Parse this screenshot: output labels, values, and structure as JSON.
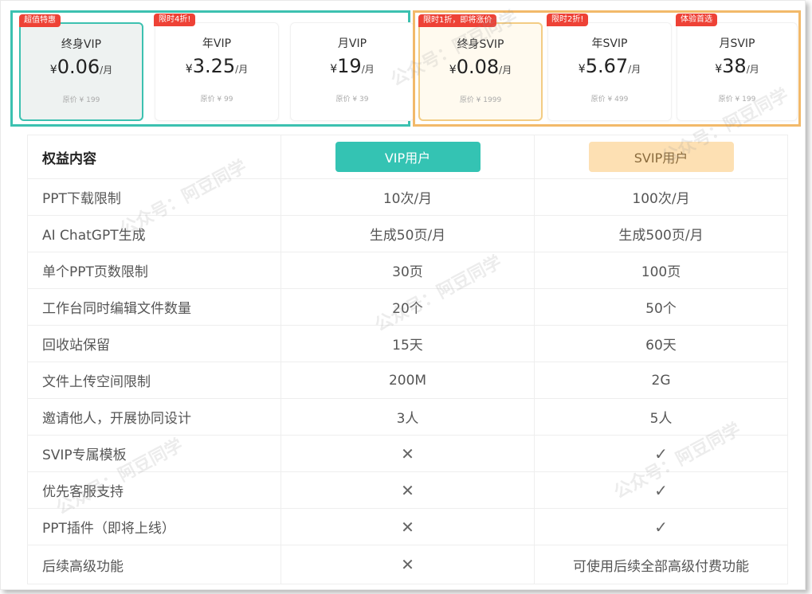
{
  "plans": {
    "vip": [
      {
        "tag": "超值特惠",
        "name": "终身VIP",
        "currency": "¥",
        "price": "0.06",
        "unit": "/月",
        "original": "原价 ¥ 199"
      },
      {
        "tag": "限时4折!",
        "name": "年VIP",
        "currency": "¥",
        "price": "3.25",
        "unit": "/月",
        "original": "原价 ¥ 99"
      },
      {
        "tag": "",
        "name": "月VIP",
        "currency": "¥",
        "price": "19",
        "unit": "/月",
        "original": "原价 ¥ 39"
      }
    ],
    "svip": [
      {
        "tag": "限时1折，即将涨价",
        "name": "终身SVIP",
        "currency": "¥",
        "price": "0.08",
        "unit": "/月",
        "original": "原价 ¥ 1999"
      },
      {
        "tag": "限时2折!",
        "name": "年SVIP",
        "currency": "¥",
        "price": "5.67",
        "unit": "/月",
        "original": "原价 ¥ 499"
      },
      {
        "tag": "体验首选",
        "name": "月SVIP",
        "currency": "¥",
        "price": "38",
        "unit": "/月",
        "original": "原价 ¥ 199"
      }
    ]
  },
  "table": {
    "header": {
      "feature": "权益内容",
      "vip": "VIP用户",
      "svip": "SVIP用户"
    },
    "rows": [
      {
        "feature": "PPT下载限制",
        "vip": "10次/月",
        "svip": "100次/月"
      },
      {
        "feature": "AI ChatGPT生成",
        "vip": "生成50页/月",
        "svip": "生成500页/月"
      },
      {
        "feature": "单个PPT页数限制",
        "vip": "30页",
        "svip": "100页"
      },
      {
        "feature": "工作台同时编辑文件数量",
        "vip": "20个",
        "svip": "50个"
      },
      {
        "feature": "回收站保留",
        "vip": "15天",
        "svip": "60天"
      },
      {
        "feature": "文件上传空间限制",
        "vip": "200M",
        "svip": "2G"
      },
      {
        "feature": "邀请他人，开展协同设计",
        "vip": "3人",
        "svip": "5人"
      },
      {
        "feature": "SVIP专属模板",
        "vip": "✕",
        "svip": "✓"
      },
      {
        "feature": "优先客服支持",
        "vip": "✕",
        "svip": "✓"
      },
      {
        "feature": "PPT插件（即将上线）",
        "vip": "✕",
        "svip": "✓"
      },
      {
        "feature": "后续高级功能",
        "vip": "✕",
        "svip": "可使用后续全部高级付费功能"
      }
    ]
  },
  "watermark": "公众号：阿豆同学",
  "colors": {
    "vip_accent": "#3cc1b0",
    "svip_accent": "#f2b96a",
    "tag_red": "#ee4236"
  }
}
